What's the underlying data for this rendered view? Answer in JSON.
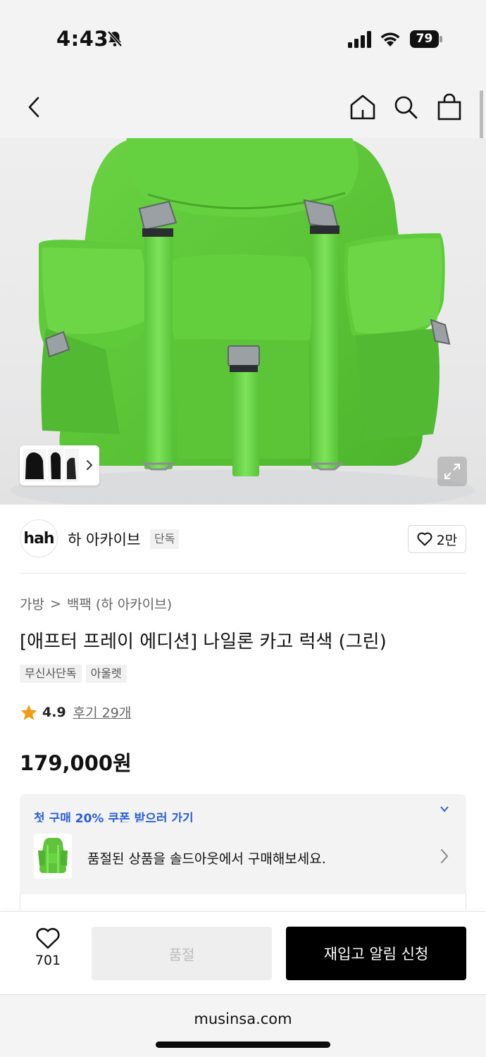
{
  "status_bar": {
    "time": "4:43",
    "battery": "79"
  },
  "product": {
    "brand": {
      "logo_text": "hah",
      "name": "하 아카이브",
      "badge": "단독",
      "likes": "2만"
    },
    "breadcrumb": {
      "category": "가방",
      "separator": ">",
      "subcategory": "백팩 (하 아카이브)"
    },
    "title": "[애프터 프레이 에디션] 나일론 카고 럭색 (그린)",
    "tags": [
      "무신사단독",
      "아울렛"
    ],
    "rating": {
      "score": "4.9",
      "review_label": "후기 29개"
    },
    "price": "179,000원",
    "image_color": "#5fc43b"
  },
  "promo": {
    "coupon_text": "첫 구매 20% 쿠폰 받으러 가기",
    "soldout_text": "품절된 상품을 솔드아웃에서 구매해보세요."
  },
  "bottom_bar": {
    "wish_count": "701",
    "soldout_label": "품절",
    "restock_label": "재입고 알림 신청"
  },
  "browser": {
    "url": "musinsa.com"
  }
}
